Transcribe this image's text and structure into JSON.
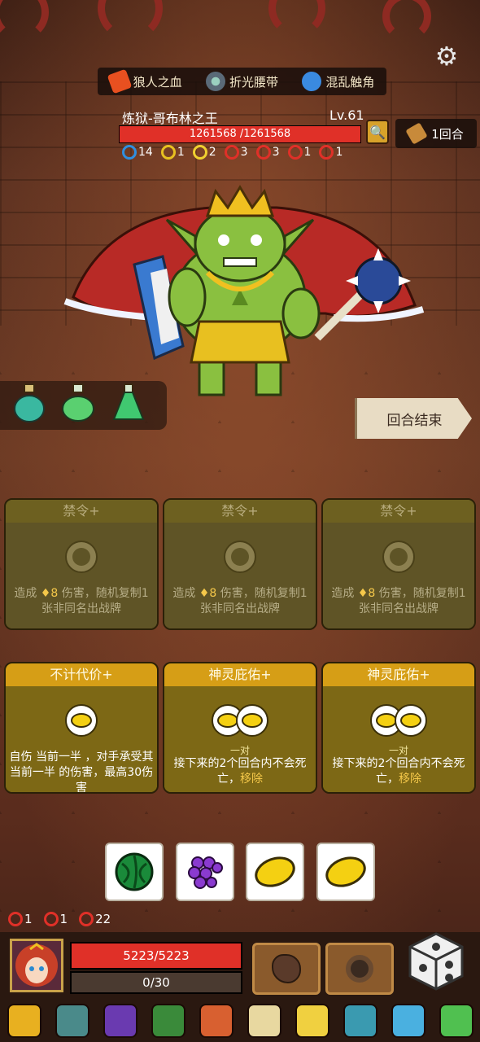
{
  "relics": [
    {
      "icon": "werewolf-blood-icon",
      "label": "狼人之血"
    },
    {
      "icon": "refraction-belt-icon",
      "label": "折光腰带"
    },
    {
      "icon": "chaos-tentacle-icon",
      "label": "混乱触角"
    }
  ],
  "enemy": {
    "name": "炼狱-哥布林之王",
    "level": "Lv.61",
    "hp_text": "1261568 /1261568",
    "hp_fraction": 1.0,
    "statuses": [
      {
        "icon": "blue-ring-icon",
        "value": "14",
        "color": "#2f8fe0"
      },
      {
        "icon": "shield-icon",
        "value": "1",
        "color": "#e8c020"
      },
      {
        "icon": "sparkle-icon",
        "value": "2",
        "color": "#f0d030"
      },
      {
        "icon": "red-rune-icon",
        "value": "3",
        "color": "#e03028"
      },
      {
        "icon": "red-bolt-icon",
        "value": "3",
        "color": "#e03028"
      },
      {
        "icon": "red-spiral-icon",
        "value": "1",
        "color": "#e03028"
      },
      {
        "icon": "red-slash-icon",
        "value": "1",
        "color": "#e03028"
      }
    ]
  },
  "round": "1回合",
  "end_turn": "回合结束",
  "cards_top": [
    {
      "title": "禁令+",
      "desc_a": "造成",
      "desc_gem": "8",
      "desc_b": "伤害，随机复制1张非同名出战牌"
    },
    {
      "title": "禁令+",
      "desc_a": "造成",
      "desc_gem": "8",
      "desc_b": "伤害，随机复制1张非同名出战牌"
    },
    {
      "title": "禁令+",
      "desc_a": "造成",
      "desc_gem": "8",
      "desc_b": "伤害，随机复制1张非同名出战牌"
    }
  ],
  "cards_bottom": [
    {
      "title": "不计代价+",
      "desc": "自伤 当前一半 ，对手承受其当前一半 的伤害，最高30伤害"
    },
    {
      "title": "神灵庇佑+",
      "pair": "一对",
      "desc_a": "接下来的2个回合内不会死亡，",
      "desc_hl": "移除"
    },
    {
      "title": "神灵庇佑+",
      "pair": "一对",
      "desc_a": "接下来的2个回合内不会死亡，",
      "desc_hl": "移除"
    }
  ],
  "dice": [
    "watermelon-icon",
    "grape-icon",
    "lemon-icon",
    "lemon-icon"
  ],
  "player": {
    "statuses": [
      {
        "icon": "red-spiral-icon",
        "value": "1"
      },
      {
        "icon": "red-slash-icon",
        "value": "1"
      },
      {
        "icon": "red-gear-icon",
        "value": "22"
      }
    ],
    "hp_text": "5223/5223",
    "shield_text": "0/30"
  },
  "items": [
    "ring-icon",
    "relic-disc-icon",
    "hat-icon",
    "book-icon",
    "meat-icon",
    "horn-icon",
    "sun-medal-icon",
    "armor-icon",
    "crest-icon",
    "flame-gem-icon"
  ]
}
